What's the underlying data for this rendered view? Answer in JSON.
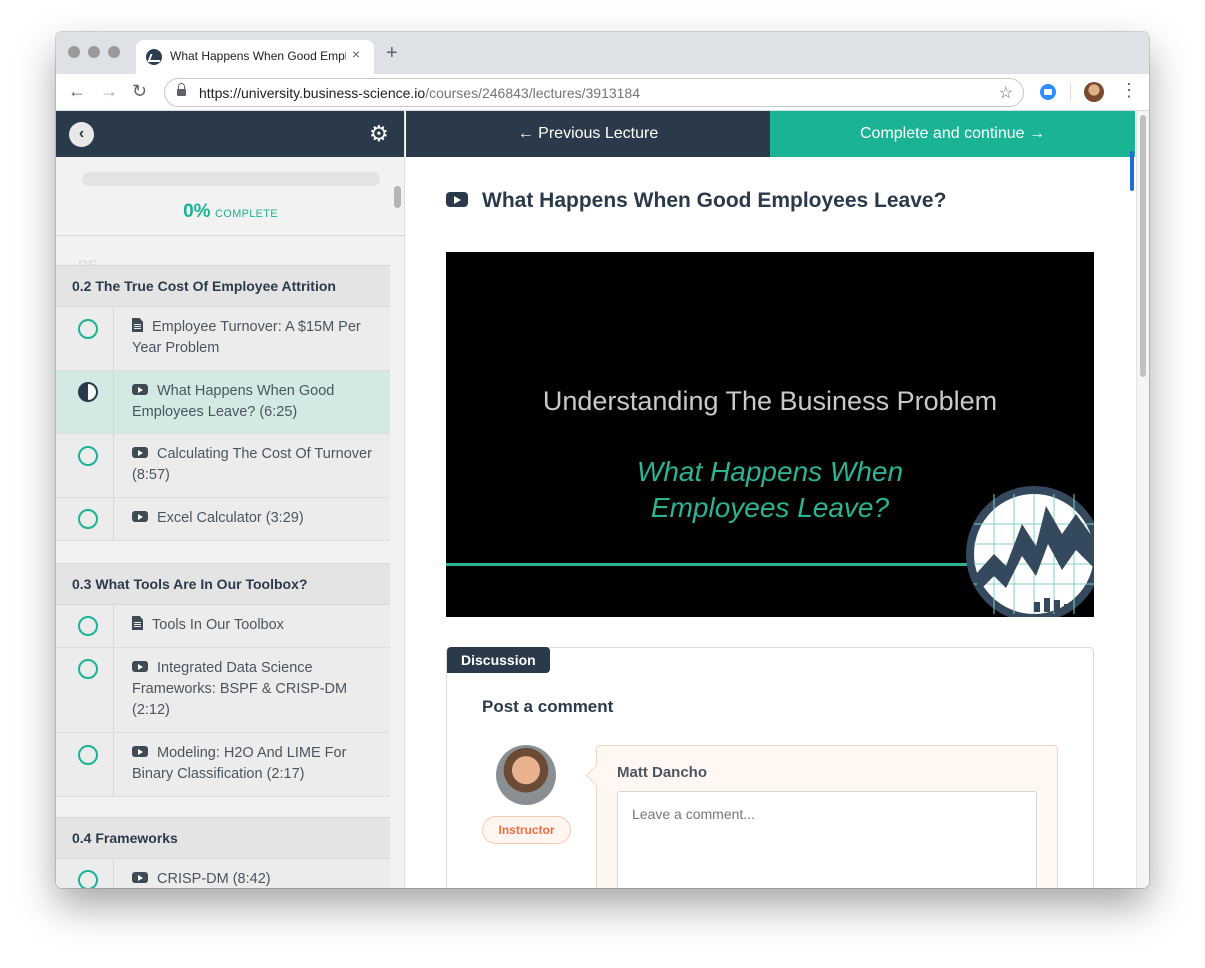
{
  "browser": {
    "tab_title": "What Happens When Good Employees Leave?",
    "tab_close": "×",
    "new_tab": "+",
    "url_host": "https://university.business-science.io",
    "url_path": "/courses/246843/lectures/3913184",
    "back_glyph": "←",
    "forward_glyph": "→",
    "reload_glyph": "↻",
    "star_glyph": "☆",
    "menu_glyph": "⋮"
  },
  "sidebar": {
    "back_glyph": "‹",
    "gear_glyph": "⚙",
    "progress_value": "0%",
    "progress_label": "COMPLETE",
    "progress_fraction": 0,
    "ghost_text": "RE...",
    "sections": [
      {
        "title": "0.2 The True Cost Of Employee Attrition",
        "lectures": [
          {
            "type": "doc",
            "label": "Employee Turnover: A $15M Per Year Problem",
            "status": "incomplete"
          },
          {
            "type": "video",
            "label": "What Happens When Good Employees Leave? (6:25)",
            "status": "in-progress"
          },
          {
            "type": "video",
            "label": "Calculating The Cost Of Turnover (8:57)",
            "status": "incomplete"
          },
          {
            "type": "video",
            "label": "Excel Calculator (3:29)",
            "status": "incomplete"
          }
        ]
      },
      {
        "title": "0.3 What Tools Are In Our Toolbox?",
        "lectures": [
          {
            "type": "doc",
            "label": "Tools In Our Toolbox",
            "status": "incomplete"
          },
          {
            "type": "video",
            "label": "Integrated Data Science Frameworks: BSPF & CRISP-DM (2:12)",
            "status": "incomplete"
          },
          {
            "type": "video",
            "label": "Modeling: H2O And LIME For Binary Classification (2:17)",
            "status": "incomplete"
          }
        ]
      },
      {
        "title": "0.4 Frameworks",
        "lectures": [
          {
            "type": "video",
            "label": "CRISP-DM (8:42)",
            "status": "incomplete"
          }
        ]
      }
    ]
  },
  "nav": {
    "previous_label": "← Previous Lecture",
    "next_label": "Complete and continue →"
  },
  "lecture": {
    "title": "What Happens When Good Employees Leave?",
    "video_heading": "Understanding The Business Problem",
    "video_subtitle": "What Happens When Employees Leave?"
  },
  "discussion": {
    "tab_label": "Discussion",
    "post_title": "Post a comment",
    "commenter_name": "Matt Dancho",
    "role_badge": "Instructor",
    "comment_placeholder": "Leave a comment..."
  },
  "colors": {
    "primary_dark": "#2b3a4a",
    "accent_green": "#1ab394",
    "active_row": "#d2e9e4",
    "instructor_orange": "#f26b3a"
  }
}
